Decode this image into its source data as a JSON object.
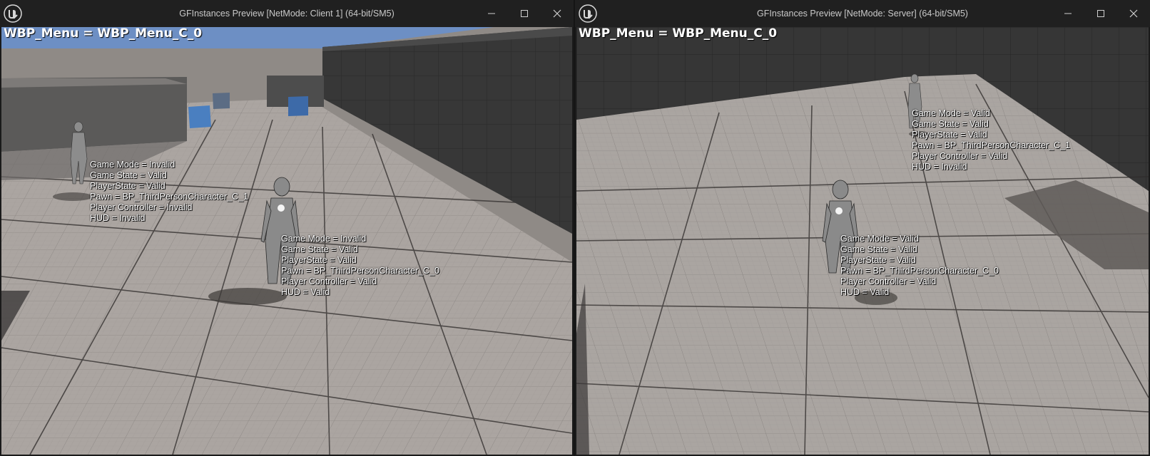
{
  "client_window": {
    "title": "GFInstances Preview [NetMode: Client 1]  (64-bit/SM5)",
    "overlay_label": "WBP_Menu = WBP_Menu_C_0",
    "characters": [
      {
        "lines": [
          "Game Mode = Invalid",
          "Game State = Valid",
          "PlayerState = Valid",
          "Pawn = BP_ThirdPersonCharacter_C_1",
          "Player Controller = Invalid",
          "HUD = Invalid"
        ]
      },
      {
        "lines": [
          "Game Mode = Invalid",
          "Game State = Valid",
          "PlayerState = Valid",
          "Pawn = BP_ThirdPersonCharacter_C_0",
          "Player Controller = Valid",
          "HUD = Valid"
        ]
      }
    ]
  },
  "server_window": {
    "title": "GFInstances Preview [NetMode: Server]  (64-bit/SM5)",
    "overlay_label": "WBP_Menu = WBP_Menu_C_0",
    "characters": [
      {
        "lines": [
          "Game Mode = Valid",
          "Game State = Valid",
          "PlayerState = Valid",
          "Pawn = BP_ThirdPersonCharacter_C_1",
          "Player Controller = Valid",
          "HUD = Invalid"
        ]
      },
      {
        "lines": [
          "Game Mode = Valid",
          "Game State = Valid",
          "PlayerState = Valid",
          "Pawn = BP_ThirdPersonCharacter_C_0",
          "Player Controller = Valid",
          "HUD = Valid"
        ]
      }
    ]
  },
  "icons": {
    "logo": "unreal-engine-logo-icon",
    "minimize": "minimize-icon",
    "maximize": "maximize-icon",
    "close": "close-icon"
  },
  "colors": {
    "titlebar": "#202020",
    "floor": "#a9a39f",
    "wall": "#3a3a3a",
    "sky": "#6d8fc4",
    "text": "#ffffff"
  }
}
